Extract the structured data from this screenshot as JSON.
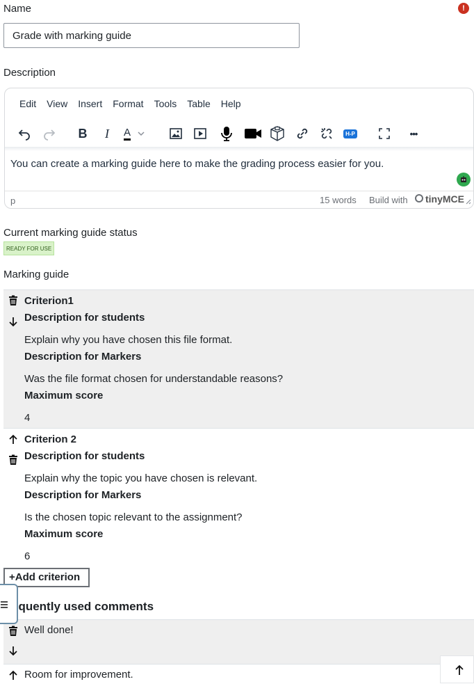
{
  "form": {
    "name_label": "Name",
    "required_icon": "exclamation-icon",
    "name_value": "Grade with marking guide",
    "description_label": "Description"
  },
  "editor": {
    "menu": [
      "Edit",
      "View",
      "Insert",
      "Format",
      "Tools",
      "Table",
      "Help"
    ],
    "toolbar_icons": [
      "undo-icon",
      "redo-icon",
      "bold-icon",
      "italic-icon",
      "text-color-icon",
      "image-icon",
      "media-icon",
      "record-audio-icon",
      "record-video-icon",
      "h5p-content-icon",
      "link-icon",
      "unlink-icon",
      "h5p-icon",
      "fullscreen-icon",
      "more-icon"
    ],
    "bold_label": "B",
    "italic_label": "I",
    "color_label": "A",
    "h5p_label": "H-P",
    "more_label": "•••",
    "content": "You can create a marking guide here to make the grading process easier for you.",
    "path": "p",
    "word_count": "15 words",
    "build_with": "Build with",
    "brand": "tinyMCE"
  },
  "status": {
    "label": "Current marking guide status",
    "badge": "READY FOR USE"
  },
  "guide": {
    "label": "Marking guide",
    "criteria": [
      {
        "title": "Criterion1",
        "students_label": "Description for students",
        "students_text": "Explain why you have chosen this file format.",
        "markers_label": "Description for Markers",
        "markers_text": "Was the file format chosen for understandable reasons?",
        "score_label": "Maximum score",
        "score": "4"
      },
      {
        "title": "Criterion 2",
        "students_label": "Description for students",
        "students_text": "Explain why the topic you have chosen is relevant.",
        "markers_label": "Description for Markers",
        "markers_text": "Is the chosen topic relevant to the assignment?",
        "score_label": "Maximum score",
        "score": "6"
      }
    ],
    "add_criterion": "Add criterion",
    "add_icon": "plus-icon"
  },
  "comments": {
    "label": "equently used comments",
    "items": [
      "Well done!",
      "Room for improvement."
    ]
  },
  "icons": {
    "delete": "trash-icon",
    "move_down": "arrow-down-icon",
    "move_up": "arrow-up-icon",
    "drawer": "menu-icon",
    "scroll_top": "arrow-up-icon"
  }
}
